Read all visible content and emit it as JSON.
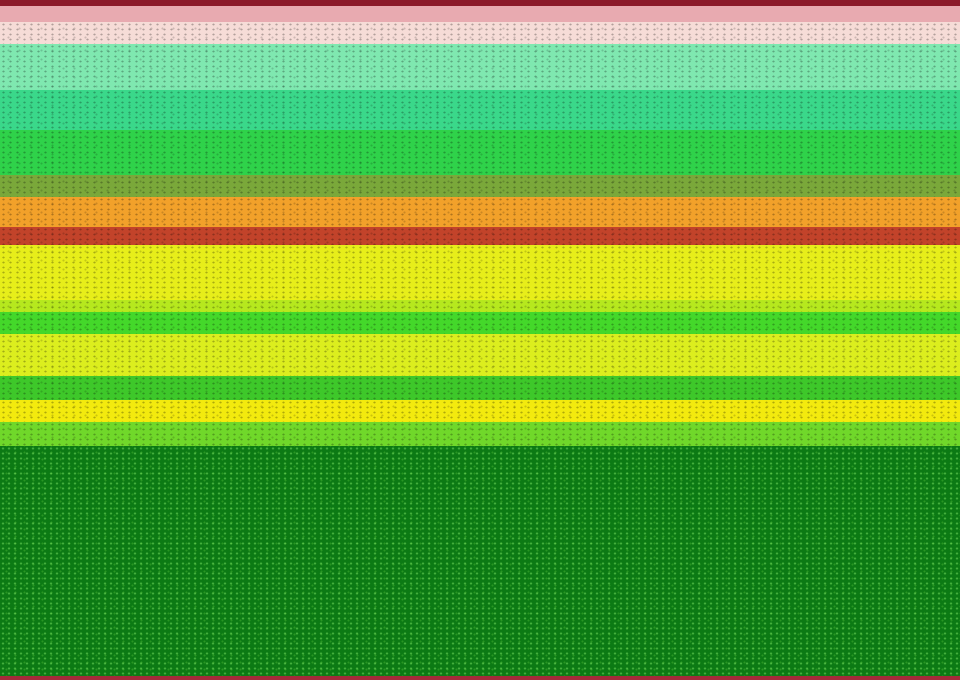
{
  "bands": [
    {
      "id": "band-maroon-top",
      "color": "#8c1a2a"
    },
    {
      "id": "band-pink",
      "color": "#e8aab0"
    },
    {
      "id": "band-pale-pink",
      "color": "#f6dcd7"
    },
    {
      "id": "band-mint",
      "color": "#7fe8b0"
    },
    {
      "id": "band-teal-green",
      "color": "#3ad88a"
    },
    {
      "id": "band-green-a",
      "color": "#2fd24a"
    },
    {
      "id": "band-olive",
      "color": "#7aa83a"
    },
    {
      "id": "band-orange",
      "color": "#f2a12a"
    },
    {
      "id": "band-red-stripe",
      "color": "#c2432a"
    },
    {
      "id": "band-yellow-a",
      "color": "#e7ee1a"
    },
    {
      "id": "band-yellow-green",
      "color": "#b6e81e"
    },
    {
      "id": "band-green-b",
      "color": "#44d82a"
    },
    {
      "id": "band-yellow-b",
      "color": "#dcee1e"
    },
    {
      "id": "band-green-c",
      "color": "#3ec82a"
    },
    {
      "id": "band-yellow-c",
      "color": "#f3ea0e"
    },
    {
      "id": "band-green-d",
      "color": "#70d82a"
    },
    {
      "id": "band-dark-green",
      "color": "#0c7a14"
    },
    {
      "id": "band-bottom-edge",
      "color": "#a42a3a"
    }
  ]
}
